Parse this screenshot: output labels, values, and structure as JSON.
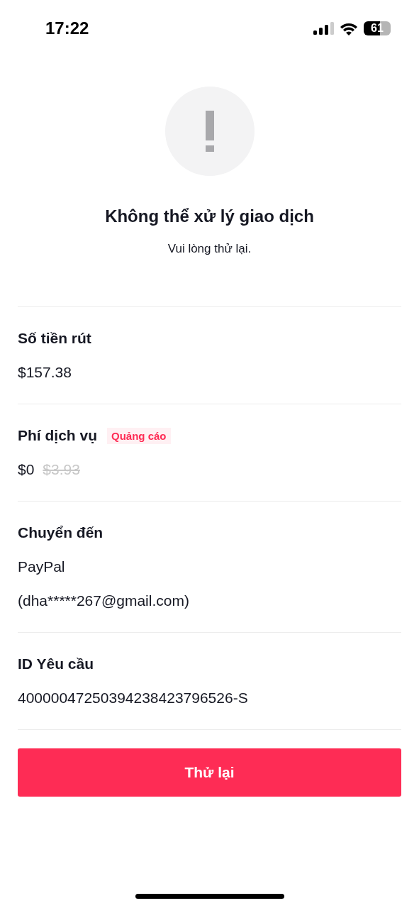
{
  "status_bar": {
    "time": "17:22",
    "battery": "61"
  },
  "result": {
    "title": "Không thể xử lý giao dịch",
    "message": "Vui lòng thử lại."
  },
  "sections": [
    {
      "label": "Số tiền rút",
      "lines": [
        [
          {
            "text": "$157.38",
            "struck": false
          }
        ]
      ]
    },
    {
      "label": "Phí dịch vụ",
      "badge": "Quảng cáo",
      "lines": [
        [
          {
            "text": "$0",
            "struck": false
          },
          {
            "text": "$3.93",
            "struck": true
          }
        ]
      ]
    },
    {
      "label": "Chuyển đến",
      "lines": [
        [
          {
            "text": "PayPal",
            "struck": false
          }
        ],
        [
          {
            "text": "(dha*****267@gmail.com)",
            "struck": false
          }
        ]
      ]
    },
    {
      "label": "ID Yêu cầu",
      "lines": [
        [
          {
            "text": "40000047250394238423796526-S",
            "struck": false
          }
        ]
      ]
    }
  ],
  "button": {
    "label": "Thử lại"
  }
}
